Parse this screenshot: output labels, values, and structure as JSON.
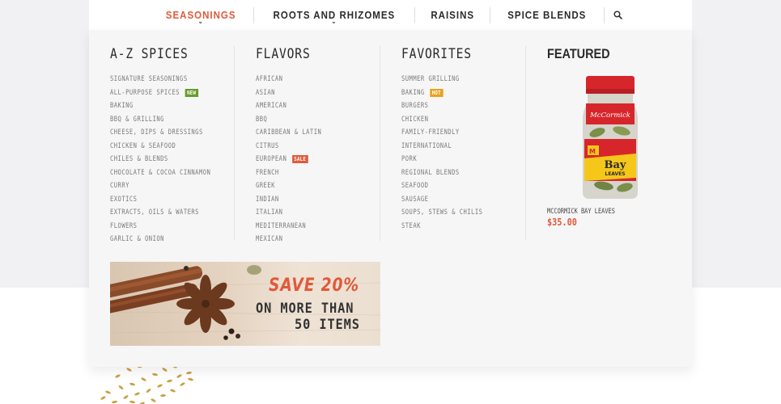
{
  "nav": {
    "items": [
      {
        "label": "SEASONINGS",
        "active": true,
        "has_caret": true
      },
      {
        "label": "ROOTS AND RHIZOMES",
        "active": false,
        "has_caret": true
      },
      {
        "label": "RAISINS",
        "active": false,
        "has_caret": false
      },
      {
        "label": "SPICE BLENDS",
        "active": false,
        "has_caret": false
      }
    ],
    "search_icon": "search-icon"
  },
  "menu": {
    "az": {
      "title": "A-Z SPICES",
      "items": [
        {
          "label": "SIGNATURE SEASONINGS"
        },
        {
          "label": "ALL-PURPOSE SPICES",
          "badge": "NEW"
        },
        {
          "label": "BAKING"
        },
        {
          "label": "BBQ & GRILLING"
        },
        {
          "label": "CHEESE, DIPS & DRESSINGS"
        },
        {
          "label": "CHICKEN & SEAFOOD"
        },
        {
          "label": "CHILES & BLENDS"
        },
        {
          "label": "CHOCOLATE & COCOA CINNAMON"
        },
        {
          "label": "CURRY"
        },
        {
          "label": "EXOTICS"
        },
        {
          "label": "EXTRACTS, OILS & WATERS"
        },
        {
          "label": "FLOWERS"
        },
        {
          "label": "GARLIC & ONION"
        }
      ]
    },
    "flavors": {
      "title": "FLAVORS",
      "items": [
        {
          "label": "AFRICAN"
        },
        {
          "label": "ASIAN"
        },
        {
          "label": "AMERICAN"
        },
        {
          "label": "BBQ"
        },
        {
          "label": "CARIBBEAN & LATIN"
        },
        {
          "label": "CITRUS"
        },
        {
          "label": "EUROPEAN",
          "badge": "SALE"
        },
        {
          "label": "FRENCH"
        },
        {
          "label": "GREEK"
        },
        {
          "label": "INDIAN"
        },
        {
          "label": "ITALIAN"
        },
        {
          "label": "MEDITERRANEAN"
        },
        {
          "label": "MEXICAN"
        }
      ]
    },
    "favorites": {
      "title": "FAVORITES",
      "items": [
        {
          "label": "SUMMER GRILLING"
        },
        {
          "label": "BAKING",
          "badge": "HOT"
        },
        {
          "label": "BURGERS"
        },
        {
          "label": "CHICKEN"
        },
        {
          "label": "FAMILY-FRIENDLY"
        },
        {
          "label": "INTERNATIONAL"
        },
        {
          "label": "PORK"
        },
        {
          "label": "REGIONAL BLENDS"
        },
        {
          "label": "SEAFOOD"
        },
        {
          "label": "SAUSAGE"
        },
        {
          "label": "SOUPS, STEWS & CHILIS"
        },
        {
          "label": "STEAK"
        }
      ]
    },
    "featured": {
      "title": "FEATURED",
      "product_name": "MCCORMICK BAY LEAVES",
      "price": "$35.00",
      "jar_brand": "McCormick",
      "jar_label_line1": "Bay",
      "jar_label_line2": "LEAVES"
    },
    "banner": {
      "line1": "SAVE 20%",
      "line2": "ON MORE THAN",
      "line3": "50 ITEMS"
    }
  },
  "colors": {
    "accent": "#e05a3a",
    "badge_new": "#6a9a2c",
    "badge_sale": "#e05a3a",
    "badge_hot": "#e8a21e"
  }
}
